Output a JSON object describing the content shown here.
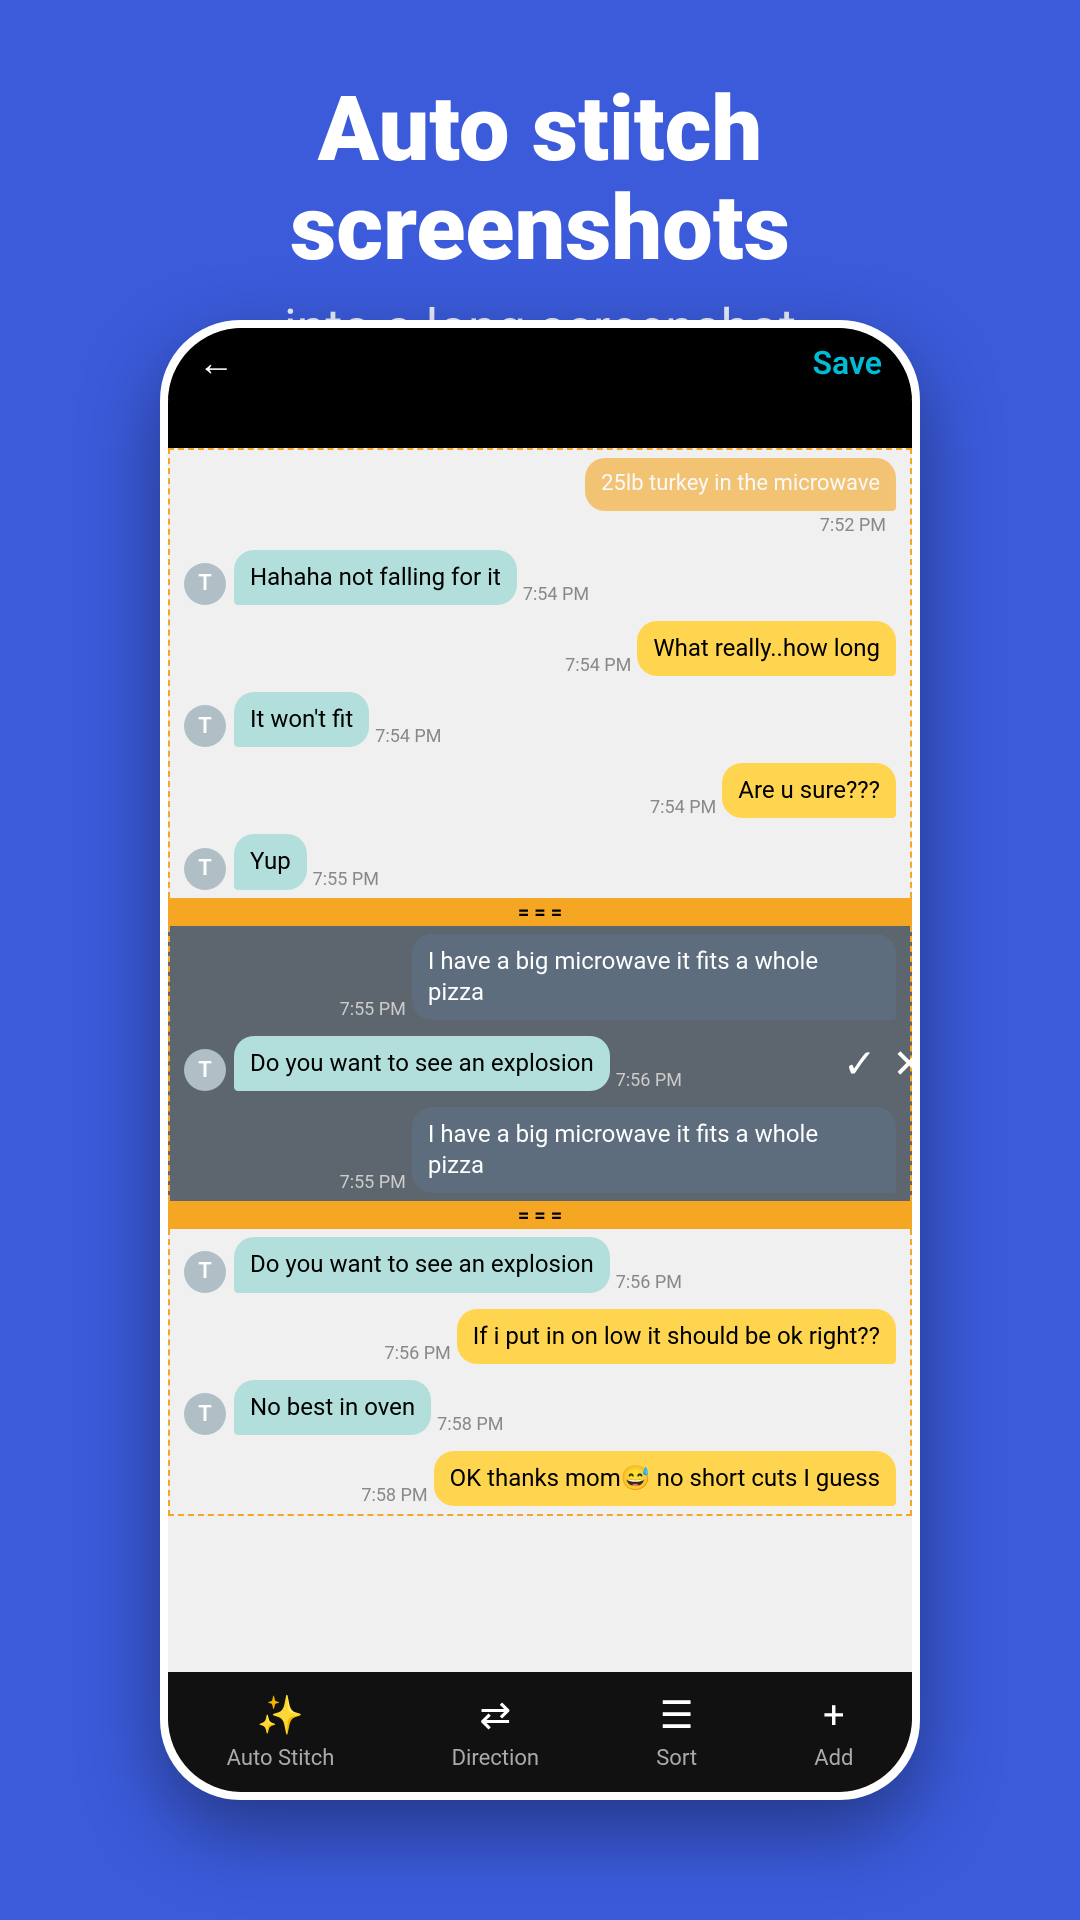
{
  "header": {
    "main_title": "Auto stitch screenshots",
    "subtitle": "into a long screenshot"
  },
  "phone": {
    "top_bar": {
      "save_label": "Save"
    },
    "messages": [
      {
        "type": "sent",
        "text": "25lb turkey in the microwave",
        "time": "7:52 PM",
        "style": "orange"
      },
      {
        "type": "received",
        "text": "Hahaha not falling for it",
        "time": "7:54 PM"
      },
      {
        "type": "sent",
        "text": "What really..how long",
        "time": "7:54 PM"
      },
      {
        "type": "received",
        "text": "It won't fit",
        "time": "7:54 PM"
      },
      {
        "type": "sent",
        "text": "Are u sure???",
        "time": "7:54 PM"
      },
      {
        "type": "received",
        "text": "Yup",
        "time": "7:55 PM"
      },
      {
        "type": "sent",
        "text": "I have a big microwave it fits a whole pizza",
        "time": "7:55 PM",
        "style": "dark"
      },
      {
        "type": "received",
        "text": "Do you want to see an explosion",
        "time": "7:56 PM"
      },
      {
        "type": "sent",
        "text": "I have a big microwave it fits a whole pizza",
        "time": "7:55 PM",
        "style": "dark"
      },
      {
        "type": "received",
        "text": "Do you want to see an explosion",
        "time": "7:56 PM"
      },
      {
        "type": "sent",
        "text": "If i put in on low it should be ok right??",
        "time": "7:56 PM"
      },
      {
        "type": "received",
        "text": "No best in oven",
        "time": "7:58 PM"
      },
      {
        "type": "sent",
        "text": "OK thanks mom😅 no short cuts I guess",
        "time": "7:58 PM"
      }
    ],
    "toolbar": {
      "auto_stitch_label": "Auto Stitch",
      "direction_label": "Direction",
      "sort_label": "Sort",
      "add_label": "Add"
    }
  }
}
